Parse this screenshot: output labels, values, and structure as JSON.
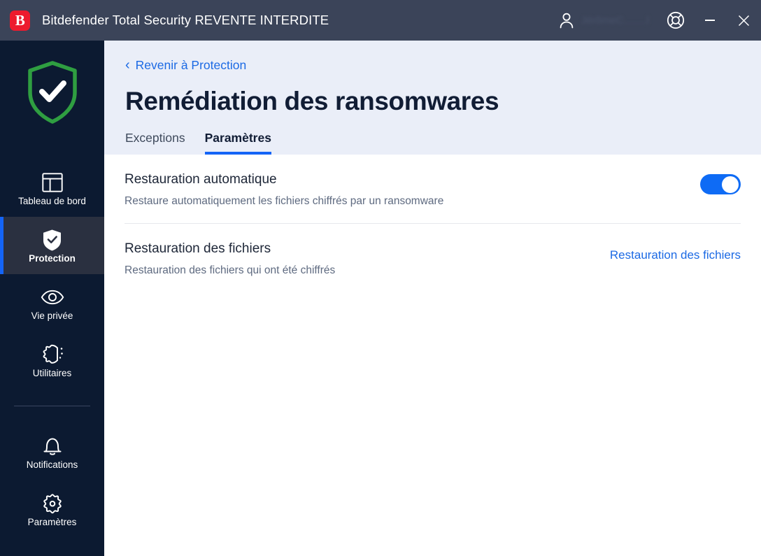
{
  "window": {
    "logo_letter": "B",
    "title": "Bitdefender Total Security REVENTE INTERDITE",
    "account_name": "JérômeC........l",
    "account_icon": "user-icon",
    "support_icon": "lifebuoy-icon",
    "minimize_label": "—",
    "close_label": "✕"
  },
  "sidebar": {
    "status_icon": "shield-check-icon",
    "status_color": "#2f9e41",
    "items": [
      {
        "label": "Tableau de bord",
        "icon": "dashboard-icon",
        "active": false
      },
      {
        "label": "Protection",
        "icon": "shield-check-small-icon",
        "active": true
      },
      {
        "label": "Vie privée",
        "icon": "eye-icon",
        "active": false
      },
      {
        "label": "Utilitaires",
        "icon": "gear-sparkle-icon",
        "active": false
      }
    ],
    "bottom_items": [
      {
        "label": "Notifications",
        "icon": "bell-icon",
        "active": false
      },
      {
        "label": "Paramètres",
        "icon": "gear-icon",
        "active": false
      }
    ],
    "accent_color": "#1464f6",
    "background": "#0c1a31"
  },
  "main": {
    "back_link": "Revenir à Protection",
    "back_chevron": "‹",
    "page_title": "Remédiation des ransomwares",
    "tabs": [
      {
        "label": "Exceptions",
        "active": false
      },
      {
        "label": "Paramètres",
        "active": true
      }
    ],
    "settings": [
      {
        "title": "Restauration automatique",
        "description": "Restaure automatiquement les fichiers chiffrés par un ransomware",
        "control": "toggle",
        "toggle_on": true
      },
      {
        "title": "Restauration des fichiers",
        "description": "Restauration des fichiers qui ont été chiffrés",
        "control": "link",
        "link_label": "Restauration des fichiers"
      }
    ]
  },
  "colors": {
    "titlebar": "#3b4459",
    "sidebar": "#0c1a31",
    "header_band": "#eaeef8",
    "accent_blue": "#1464f6",
    "link_blue": "#1c6ae4",
    "brand_red": "#ed1b2e",
    "shield_green": "#2f9e41"
  }
}
